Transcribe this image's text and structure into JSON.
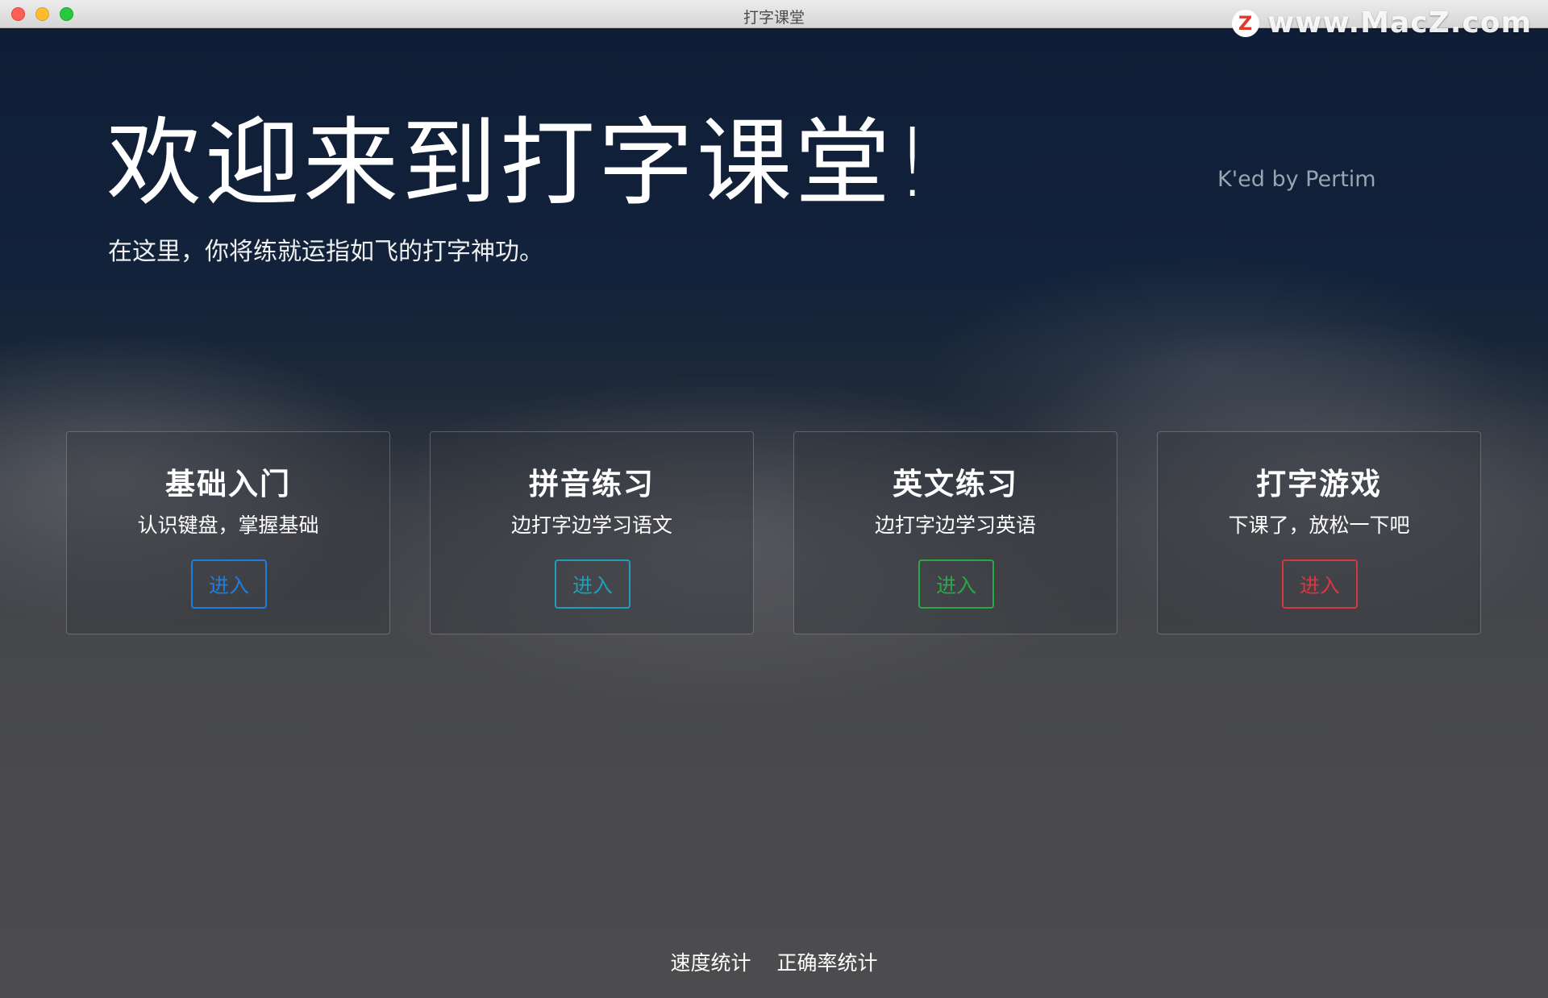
{
  "window": {
    "title": "打字课堂"
  },
  "watermark": {
    "logo_letter": "Z",
    "text": "www.MacZ.com"
  },
  "hero": {
    "title": "欢迎来到打字课堂!",
    "subtitle": "在这里，你将练就运指如飞的打字神功。",
    "credit": "K'ed by Pertim"
  },
  "cards": [
    {
      "title": "基础入门",
      "description": "认识键盘，掌握基础",
      "button_label": "进入",
      "accent_color": "#1e7ee0"
    },
    {
      "title": "拼音练习",
      "description": "边打字边学习语文",
      "button_label": "进入",
      "accent_color": "#1aa0b8"
    },
    {
      "title": "英文练习",
      "description": "边打字边学习英语",
      "button_label": "进入",
      "accent_color": "#2aa845"
    },
    {
      "title": "打字游戏",
      "description": "下课了，放松一下吧",
      "button_label": "进入",
      "accent_color": "#d9363e"
    }
  ],
  "footer": {
    "speed_stats": "速度统计",
    "accuracy_stats": "正确率统计"
  }
}
